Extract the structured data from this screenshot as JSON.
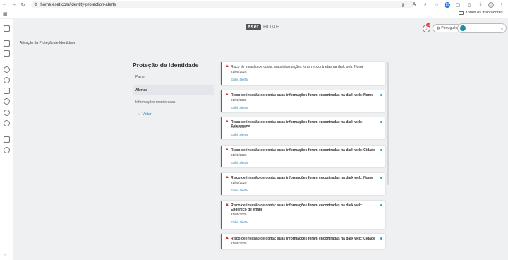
{
  "browser": {
    "url": "home.eset.com/identity-protection-alerts",
    "bookmarks_folder": "Todos os marcadores",
    "extension_badge": "19"
  },
  "header": {
    "logo_brand": "eset",
    "logo_suffix": "HOME",
    "notification_count": "16",
    "language": "Português"
  },
  "breadcrumb": "Ativação da Proteção de Identidade",
  "sidebar": {
    "title": "Proteção de identidade",
    "items": [
      {
        "label": "Painel"
      },
      {
        "label": "Alertas"
      },
      {
        "label": "Informações monitoradas"
      }
    ],
    "back_label": "Voltar"
  },
  "alerts": [
    {
      "title": "Risco de invasão de conta: suas informações foram encontradas na dark web: Nome",
      "date": "21/05/2025",
      "link": "Exibir alerta",
      "bold": false,
      "unread": false
    },
    {
      "title": "Risco de invasão de conta: suas informações foram encontradas na dark web: Nome",
      "date": "21/05/2025",
      "link": "Exibir alerta",
      "bold": true,
      "unread": true
    },
    {
      "title": "Risco de invasão de conta: suas informações foram encontradas na dark web: Sobrenome",
      "date": "21/05/2025",
      "link": "Exibir alerta",
      "bold": true,
      "unread": true
    },
    {
      "title": "Risco de invasão de conta: suas informações foram encontradas na dark web: Cidade",
      "date": "21/05/2025",
      "link": "Exibir alerta",
      "bold": true,
      "unread": true
    },
    {
      "title": "Risco de invasão de conta: suas informações foram encontradas na dark web: Nome",
      "date": "21/05/2025",
      "link": "Exibir alerta",
      "bold": true,
      "unread": true
    },
    {
      "title": "Risco de invasão de conta: suas informações foram encontradas na dark web: Endereço de email",
      "date": "21/05/2025",
      "link": "Exibir alerta",
      "bold": true,
      "unread": true
    },
    {
      "title": "Risco de invasão de conta: suas informações foram encontradas na dark web: Cidade",
      "date": "21/05/2025",
      "link": "",
      "bold": true,
      "unread": true
    }
  ]
}
